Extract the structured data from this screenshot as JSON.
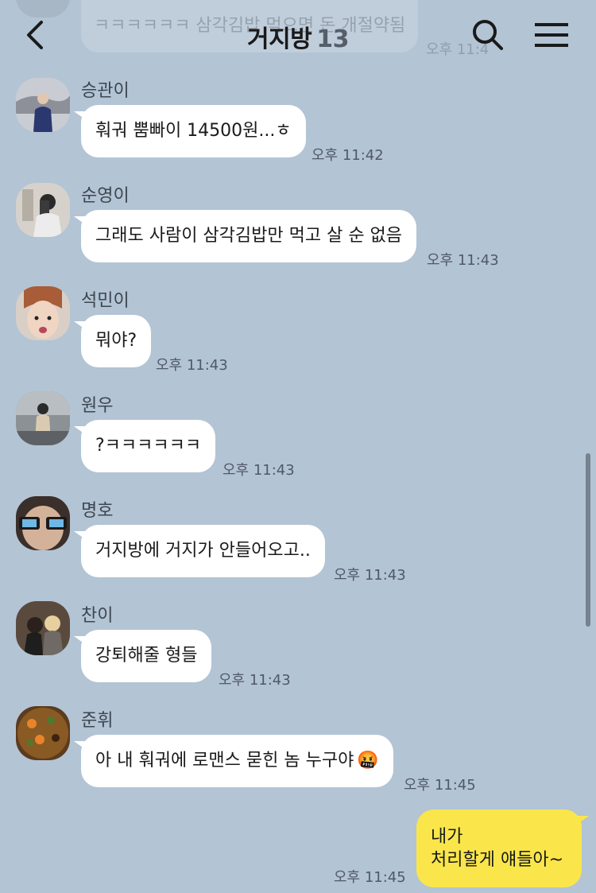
{
  "header": {
    "title": "거지방",
    "member_count": "13"
  },
  "previous_message": {
    "text": "ㅋㅋㅋㅋㅋㅋ 삼각김밥 먹으면 돈 개절약됨",
    "time": "오후 11:4"
  },
  "messages": [
    {
      "sender": "승관이",
      "text": "훠궈 뿜빠이 14500원...ㅎ",
      "time": "오후 11:42"
    },
    {
      "sender": "순영이",
      "text": "그래도 사람이 삼각김밥만 먹고 살 순 없음",
      "time": "오후 11:43"
    },
    {
      "sender": "석민이",
      "text": "뭐야?",
      "time": "오후 11:43"
    },
    {
      "sender": "원우",
      "text": "?ㅋㅋㅋㅋㅋㅋ",
      "time": "오후 11:43"
    },
    {
      "sender": "명호",
      "text": "거지방에 거지가 안들어오고..",
      "time": "오후 11:43"
    },
    {
      "sender": "찬이",
      "text": "강퇴해줄 형들",
      "time": "오후 11:43"
    },
    {
      "sender": "준휘",
      "text": "아 내 훠궈에 로맨스 묻힌 놈 누구야",
      "emoji": "🤬",
      "time": "오후 11:45"
    }
  ],
  "my_message": {
    "line1": "내가",
    "line2": "처리할게 얘들아~",
    "time": "오후 11:45"
  },
  "colors": {
    "background": "#b3c4d4",
    "my_bubble": "#fae64b",
    "other_bubble": "#ffffff"
  }
}
